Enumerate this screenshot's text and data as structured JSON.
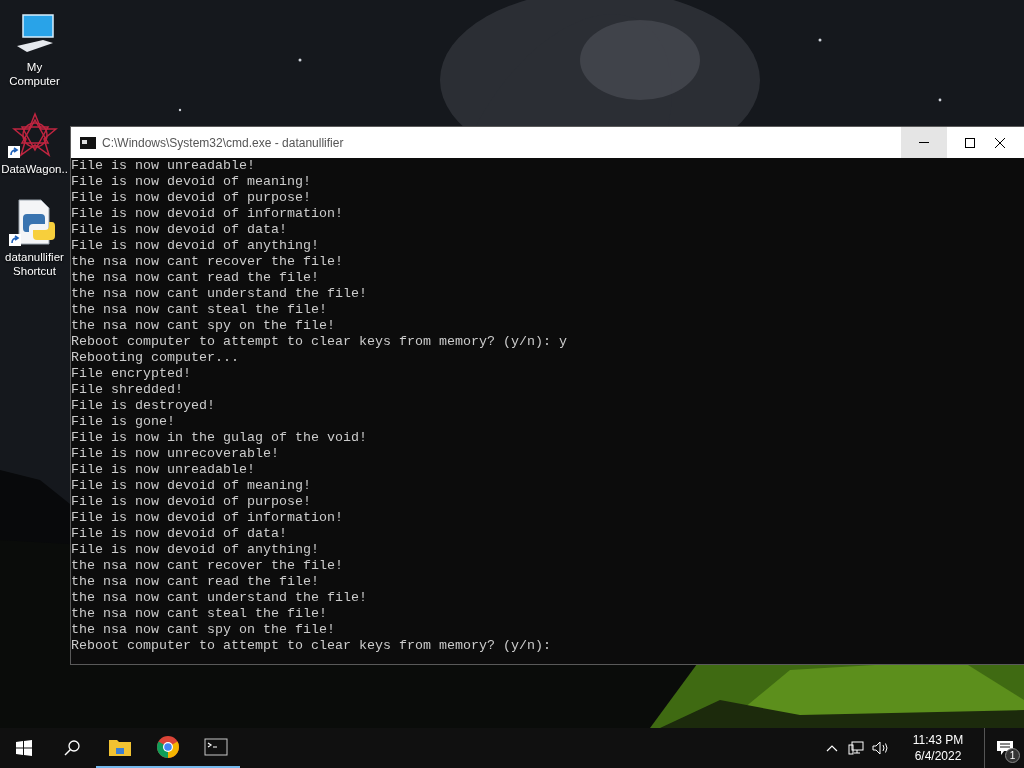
{
  "desktop_icons": [
    {
      "kind": "computer",
      "label": "My Computer",
      "shortcut": false
    },
    {
      "kind": "star",
      "label": "DataWagon..",
      "shortcut": true
    },
    {
      "kind": "script",
      "label": "datanullifier Shortcut",
      "shortcut": true
    }
  ],
  "window": {
    "title": "C:\\Windows\\System32\\cmd.exe - datanullifier",
    "lines": [
      "File is now unreadable!",
      "File is now devoid of meaning!",
      "File is now devoid of purpose!",
      "File is now devoid of information!",
      "File is now devoid of data!",
      "File is now devoid of anything!",
      "the nsa now cant recover the file!",
      "the nsa now cant read the file!",
      "the nsa now cant understand the file!",
      "the nsa now cant steal the file!",
      "the nsa now cant spy on the file!",
      "Reboot computer to attempt to clear keys from memory? (y/n): y",
      "Rebooting computer...",
      "File encrypted!",
      "File shredded!",
      "File is destroyed!",
      "File is gone!",
      "File is now in the gulag of the void!",
      "File is now unrecoverable!",
      "File is now unreadable!",
      "File is now devoid of meaning!",
      "File is now devoid of purpose!",
      "File is now devoid of information!",
      "File is now devoid of data!",
      "File is now devoid of anything!",
      "the nsa now cant recover the file!",
      "the nsa now cant read the file!",
      "the nsa now cant understand the file!",
      "the nsa now cant steal the file!",
      "the nsa now cant spy on the file!",
      "Reboot computer to attempt to clear keys from memory? (y/n):"
    ]
  },
  "taskbar": {
    "apps": [
      {
        "kind": "explorer",
        "running": true
      },
      {
        "kind": "chrome",
        "running": true
      },
      {
        "kind": "console",
        "running": true
      }
    ],
    "time": "11:43 PM",
    "date": "6/4/2022",
    "notifications": "1"
  }
}
